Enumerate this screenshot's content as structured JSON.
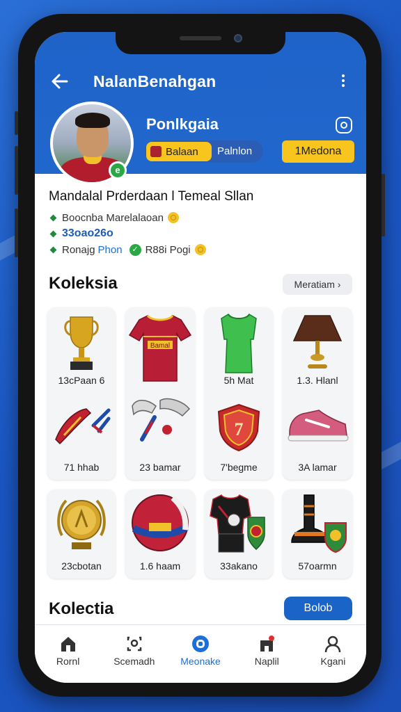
{
  "header": {
    "title": "NalanBenahgan",
    "back_icon": "back-arrow-icon",
    "more_icon": "more-vertical-icon"
  },
  "profile": {
    "name": "Ponlkgaia",
    "status_chip": "Balaan",
    "status_extra": "Palnlon",
    "medal_button": "1Medona",
    "settings_icon": "settings-icon",
    "verified_icon": "verified-badge-icon"
  },
  "bio": {
    "title": "Mandalal Prderdaan l Temeal Sllan",
    "line1": "Boocnba Marelalaoan",
    "stat": "33oao26o",
    "link_label": "Ronajg",
    "link": "Phon",
    "line3_text": "R88i Pogi"
  },
  "collection": {
    "title": "Koleksia",
    "view_all": "Meratiam",
    "items": [
      {
        "label": "13cPaan 6",
        "icon": "trophy-icon"
      },
      {
        "label": "",
        "icon": "red-jersey-icon"
      },
      {
        "label": "5h Mat",
        "icon": "green-jersey-icon"
      },
      {
        "label": "1.3. Hlanl",
        "icon": "lamp-icon"
      },
      {
        "label": "71 hhab",
        "icon": "boot-blades-icon"
      },
      {
        "label": "23 bamar",
        "icon": "shin-guards-icon"
      },
      {
        "label": "7'begme",
        "icon": "badge-icon"
      },
      {
        "label": "3A lamar",
        "icon": "sneaker-icon"
      },
      {
        "label": "23cbotan",
        "icon": "gold-medal-icon"
      },
      {
        "label": "1.6 haam",
        "icon": "ball-icon"
      },
      {
        "label": "33akano",
        "icon": "kit-icon"
      },
      {
        "label": "57oarmn",
        "icon": "boots-icon"
      }
    ],
    "jersey_text": "Bamal"
  },
  "second_section": {
    "title": "Kolectia",
    "action_button": "Bolob"
  },
  "tabbar": {
    "tabs": [
      {
        "label": "Rornl",
        "icon": "home-icon"
      },
      {
        "label": "Scemadh",
        "icon": "search-icon"
      },
      {
        "label": "Meonake",
        "icon": "profile-circle-icon",
        "active": true
      },
      {
        "label": "Naplil",
        "icon": "notifications-icon"
      },
      {
        "label": "Kgani",
        "icon": "user-icon"
      }
    ]
  },
  "colors": {
    "primary": "#1f63c9",
    "accent": "#f7c51e",
    "success": "#2aa844"
  }
}
